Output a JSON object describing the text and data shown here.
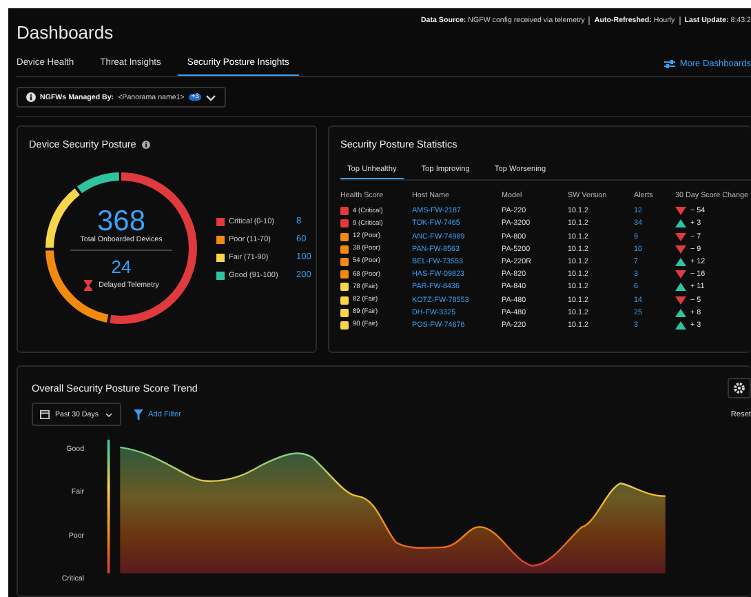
{
  "header": {
    "title": "Dashboards",
    "info": [
      {
        "label": "Data Source:",
        "value": "NGFW config received via telemetry"
      },
      {
        "label": "Auto-Refreshed:",
        "value": "Hourly"
      },
      {
        "label": "Last Update:",
        "value": "8:43:2"
      }
    ]
  },
  "tabs": [
    {
      "label": "Device Health",
      "selected": false
    },
    {
      "label": "Threat Insights",
      "selected": false
    },
    {
      "label": "Security Posture Insights",
      "selected": true
    }
  ],
  "more_dashboards": "More Dashboards",
  "filter": {
    "label": "NGFWs Managed By:",
    "value": "<Panorama name1>",
    "badge": "+3"
  },
  "posture": {
    "title": "Device Security Posture",
    "total": "368",
    "total_label": "Total Onboarded Devices",
    "delayed": "24",
    "delayed_label": "Delayed Telemetry",
    "legend": [
      {
        "label": "Critical (0-10)",
        "count": "8",
        "color": "#e0393e",
        "level": 0.53
      },
      {
        "label": "Poor (11-70)",
        "count": "60",
        "color": "#f28a0f",
        "level": 0.22
      },
      {
        "label": "Fair (71-90)",
        "count": "100",
        "color": "#f7d64a",
        "level": 0.15
      },
      {
        "label": "Good (91-100)",
        "count": "200",
        "color": "#2fc49f",
        "level": 0.1
      }
    ]
  },
  "stats": {
    "title": "Security Posture Statistics",
    "tabs": [
      {
        "label": "Top Unhealthy",
        "selected": true
      },
      {
        "label": "Top Improving",
        "selected": false
      },
      {
        "label": "Top Worsening",
        "selected": false
      }
    ],
    "columns": [
      "Health Score",
      "Host Name",
      "Model",
      "SW Version",
      "Alerts",
      "30 Day Score Change"
    ],
    "rows": [
      {
        "score": "4 (Critical)",
        "color": "#e0393e",
        "host": "AMS-FW-2187",
        "model": "PA-220",
        "version": "10.1.2",
        "alerts": "12",
        "kind": "down",
        "change": "− 54"
      },
      {
        "score": "9 (Critical)",
        "color": "#e0393e",
        "host": "TOK-FW-7465",
        "model": "PA-3200",
        "version": "10.1.2",
        "alerts": "34",
        "kind": "up",
        "change": "+ 3"
      },
      {
        "score": "12 (Poor)",
        "color": "#f28a0f",
        "host": "ANC-FW-74989",
        "model": "PA-800",
        "version": "10.1.2",
        "alerts": "9",
        "kind": "down",
        "change": "− 7"
      },
      {
        "score": "38 (Poor)",
        "color": "#f28a0f",
        "host": "PAN-FW-8563",
        "model": "PA-5200",
        "version": "10.1.2",
        "alerts": "10",
        "kind": "down",
        "change": "− 9"
      },
      {
        "score": "54 (Poor)",
        "color": "#f28a0f",
        "host": "BEL-FW-73553",
        "model": "PA-220R",
        "version": "10.1.2",
        "alerts": "7",
        "kind": "up",
        "change": "+ 12"
      },
      {
        "score": "68 (Poor)",
        "color": "#f28a0f",
        "host": "HAS-FW-09823",
        "model": "PA-820",
        "version": "10.1.2",
        "alerts": "3",
        "kind": "down",
        "change": "− 16"
      },
      {
        "score": "78 (Fair)",
        "color": "#f7d64a",
        "host": "PAR-FW-8436",
        "model": "PA-840",
        "version": "10.1.2",
        "alerts": "6",
        "kind": "up",
        "change": "+ 11"
      },
      {
        "score": "82 (Fair)",
        "color": "#f7d64a",
        "host": "KOTZ-FW-78553",
        "model": "PA-480",
        "version": "10.1.2",
        "alerts": "14",
        "kind": "down",
        "change": "− 5"
      },
      {
        "score": "89 (Fair)",
        "color": "#f7d64a",
        "host": "DH-FW-3325",
        "model": "PA-480",
        "version": "10.1.2",
        "alerts": "25",
        "kind": "up",
        "change": "+ 8"
      },
      {
        "score": "90 (Fair)",
        "color": "#f7d64a",
        "host": "POS-FW-74676",
        "model": "PA-220",
        "version": "10.1.2",
        "alerts": "3",
        "kind": "up",
        "change": "+ 3"
      }
    ]
  },
  "trend": {
    "title": "Overall Security Posture Score Trend",
    "range": "Past 30 Days",
    "add_filter": "Add Filter",
    "reset": "Reset",
    "y_labels": [
      "Good",
      "Fair",
      "Poor",
      "Critical"
    ]
  }
}
